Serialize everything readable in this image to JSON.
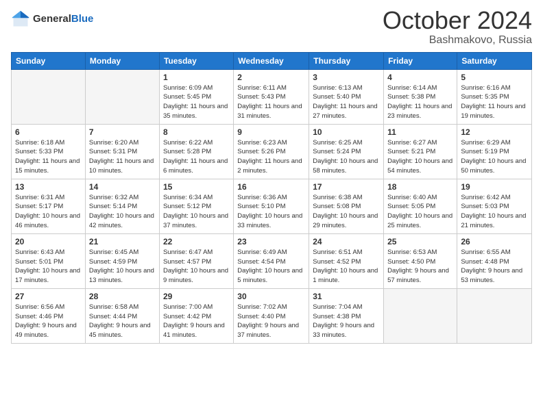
{
  "logo": {
    "line1": "General",
    "line2": "Blue"
  },
  "title": "October 2024",
  "subtitle": "Bashmakovo, Russia",
  "days_of_week": [
    "Sunday",
    "Monday",
    "Tuesday",
    "Wednesday",
    "Thursday",
    "Friday",
    "Saturday"
  ],
  "weeks": [
    [
      {
        "day": "",
        "sunrise": "",
        "sunset": "",
        "daylight": ""
      },
      {
        "day": "",
        "sunrise": "",
        "sunset": "",
        "daylight": ""
      },
      {
        "day": "1",
        "sunrise": "Sunrise: 6:09 AM",
        "sunset": "Sunset: 5:45 PM",
        "daylight": "Daylight: 11 hours and 35 minutes."
      },
      {
        "day": "2",
        "sunrise": "Sunrise: 6:11 AM",
        "sunset": "Sunset: 5:43 PM",
        "daylight": "Daylight: 11 hours and 31 minutes."
      },
      {
        "day": "3",
        "sunrise": "Sunrise: 6:13 AM",
        "sunset": "Sunset: 5:40 PM",
        "daylight": "Daylight: 11 hours and 27 minutes."
      },
      {
        "day": "4",
        "sunrise": "Sunrise: 6:14 AM",
        "sunset": "Sunset: 5:38 PM",
        "daylight": "Daylight: 11 hours and 23 minutes."
      },
      {
        "day": "5",
        "sunrise": "Sunrise: 6:16 AM",
        "sunset": "Sunset: 5:35 PM",
        "daylight": "Daylight: 11 hours and 19 minutes."
      }
    ],
    [
      {
        "day": "6",
        "sunrise": "Sunrise: 6:18 AM",
        "sunset": "Sunset: 5:33 PM",
        "daylight": "Daylight: 11 hours and 15 minutes."
      },
      {
        "day": "7",
        "sunrise": "Sunrise: 6:20 AM",
        "sunset": "Sunset: 5:31 PM",
        "daylight": "Daylight: 11 hours and 10 minutes."
      },
      {
        "day": "8",
        "sunrise": "Sunrise: 6:22 AM",
        "sunset": "Sunset: 5:28 PM",
        "daylight": "Daylight: 11 hours and 6 minutes."
      },
      {
        "day": "9",
        "sunrise": "Sunrise: 6:23 AM",
        "sunset": "Sunset: 5:26 PM",
        "daylight": "Daylight: 11 hours and 2 minutes."
      },
      {
        "day": "10",
        "sunrise": "Sunrise: 6:25 AM",
        "sunset": "Sunset: 5:24 PM",
        "daylight": "Daylight: 10 hours and 58 minutes."
      },
      {
        "day": "11",
        "sunrise": "Sunrise: 6:27 AM",
        "sunset": "Sunset: 5:21 PM",
        "daylight": "Daylight: 10 hours and 54 minutes."
      },
      {
        "day": "12",
        "sunrise": "Sunrise: 6:29 AM",
        "sunset": "Sunset: 5:19 PM",
        "daylight": "Daylight: 10 hours and 50 minutes."
      }
    ],
    [
      {
        "day": "13",
        "sunrise": "Sunrise: 6:31 AM",
        "sunset": "Sunset: 5:17 PM",
        "daylight": "Daylight: 10 hours and 46 minutes."
      },
      {
        "day": "14",
        "sunrise": "Sunrise: 6:32 AM",
        "sunset": "Sunset: 5:14 PM",
        "daylight": "Daylight: 10 hours and 42 minutes."
      },
      {
        "day": "15",
        "sunrise": "Sunrise: 6:34 AM",
        "sunset": "Sunset: 5:12 PM",
        "daylight": "Daylight: 10 hours and 37 minutes."
      },
      {
        "day": "16",
        "sunrise": "Sunrise: 6:36 AM",
        "sunset": "Sunset: 5:10 PM",
        "daylight": "Daylight: 10 hours and 33 minutes."
      },
      {
        "day": "17",
        "sunrise": "Sunrise: 6:38 AM",
        "sunset": "Sunset: 5:08 PM",
        "daylight": "Daylight: 10 hours and 29 minutes."
      },
      {
        "day": "18",
        "sunrise": "Sunrise: 6:40 AM",
        "sunset": "Sunset: 5:05 PM",
        "daylight": "Daylight: 10 hours and 25 minutes."
      },
      {
        "day": "19",
        "sunrise": "Sunrise: 6:42 AM",
        "sunset": "Sunset: 5:03 PM",
        "daylight": "Daylight: 10 hours and 21 minutes."
      }
    ],
    [
      {
        "day": "20",
        "sunrise": "Sunrise: 6:43 AM",
        "sunset": "Sunset: 5:01 PM",
        "daylight": "Daylight: 10 hours and 17 minutes."
      },
      {
        "day": "21",
        "sunrise": "Sunrise: 6:45 AM",
        "sunset": "Sunset: 4:59 PM",
        "daylight": "Daylight: 10 hours and 13 minutes."
      },
      {
        "day": "22",
        "sunrise": "Sunrise: 6:47 AM",
        "sunset": "Sunset: 4:57 PM",
        "daylight": "Daylight: 10 hours and 9 minutes."
      },
      {
        "day": "23",
        "sunrise": "Sunrise: 6:49 AM",
        "sunset": "Sunset: 4:54 PM",
        "daylight": "Daylight: 10 hours and 5 minutes."
      },
      {
        "day": "24",
        "sunrise": "Sunrise: 6:51 AM",
        "sunset": "Sunset: 4:52 PM",
        "daylight": "Daylight: 10 hours and 1 minute."
      },
      {
        "day": "25",
        "sunrise": "Sunrise: 6:53 AM",
        "sunset": "Sunset: 4:50 PM",
        "daylight": "Daylight: 9 hours and 57 minutes."
      },
      {
        "day": "26",
        "sunrise": "Sunrise: 6:55 AM",
        "sunset": "Sunset: 4:48 PM",
        "daylight": "Daylight: 9 hours and 53 minutes."
      }
    ],
    [
      {
        "day": "27",
        "sunrise": "Sunrise: 6:56 AM",
        "sunset": "Sunset: 4:46 PM",
        "daylight": "Daylight: 9 hours and 49 minutes."
      },
      {
        "day": "28",
        "sunrise": "Sunrise: 6:58 AM",
        "sunset": "Sunset: 4:44 PM",
        "daylight": "Daylight: 9 hours and 45 minutes."
      },
      {
        "day": "29",
        "sunrise": "Sunrise: 7:00 AM",
        "sunset": "Sunset: 4:42 PM",
        "daylight": "Daylight: 9 hours and 41 minutes."
      },
      {
        "day": "30",
        "sunrise": "Sunrise: 7:02 AM",
        "sunset": "Sunset: 4:40 PM",
        "daylight": "Daylight: 9 hours and 37 minutes."
      },
      {
        "day": "31",
        "sunrise": "Sunrise: 7:04 AM",
        "sunset": "Sunset: 4:38 PM",
        "daylight": "Daylight: 9 hours and 33 minutes."
      },
      {
        "day": "",
        "sunrise": "",
        "sunset": "",
        "daylight": ""
      },
      {
        "day": "",
        "sunrise": "",
        "sunset": "",
        "daylight": ""
      }
    ]
  ]
}
